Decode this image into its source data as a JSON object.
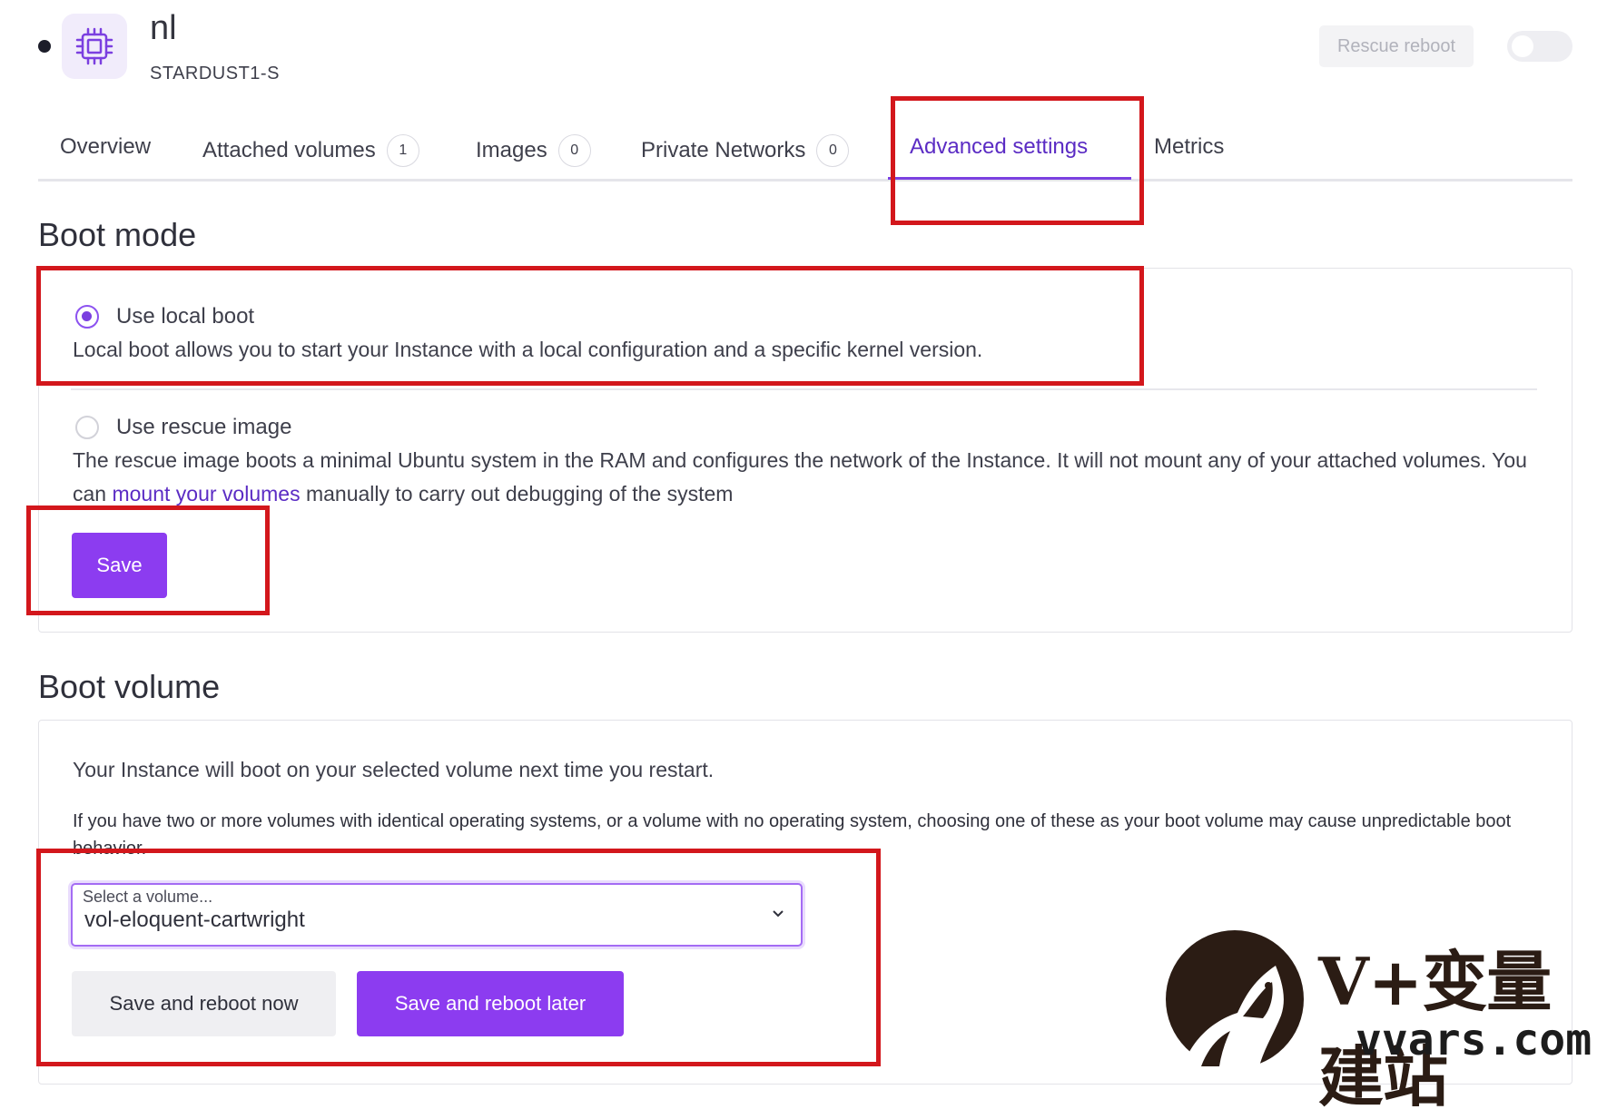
{
  "instance": {
    "name": "nl",
    "type": "STARDUST1-S",
    "status_color": "#1c1d2a"
  },
  "header": {
    "rescue_reboot_label": "Rescue reboot",
    "chip_icon": "cpu-chip-icon"
  },
  "tabs": [
    {
      "label": "Overview"
    },
    {
      "label": "Attached volumes",
      "count": "1"
    },
    {
      "label": "Images",
      "count": "0"
    },
    {
      "label": "Private Networks",
      "count": "0"
    },
    {
      "label": "Advanced settings",
      "active": true
    },
    {
      "label": "Metrics"
    }
  ],
  "boot_mode": {
    "title": "Boot mode",
    "local": {
      "label": "Use local boot",
      "description": "Local boot allows you to start your Instance with a local configuration and a specific kernel version.",
      "selected": true
    },
    "rescue": {
      "label": "Use rescue image",
      "description_before": "The rescue image boots a minimal Ubuntu system in the RAM and configures the network of the Instance. It will not mount any of your attached volumes. You can ",
      "link_text": "mount your volumes",
      "description_after": " manually to carry out debugging of the system",
      "selected": false
    },
    "save_label": "Save"
  },
  "boot_volume": {
    "title": "Boot volume",
    "info": "Your Instance will boot on your selected volume next time you restart.",
    "warning": "If you have two or more volumes with identical operating systems, or a volume with no operating system, choosing one of these as your boot volume may cause unpredictable boot behavior.",
    "select_label": "Select a volume...",
    "select_value": "vol-eloquent-cartwright",
    "reboot_now_label": "Save and reboot now",
    "reboot_later_label": "Save and reboot later"
  },
  "watermark": {
    "cn": "V+变量建站",
    "en": "vvars.com"
  },
  "colors": {
    "accent": "#8c3cf0",
    "active_tab": "#5b2cc4",
    "highlight": "#d3171c"
  }
}
